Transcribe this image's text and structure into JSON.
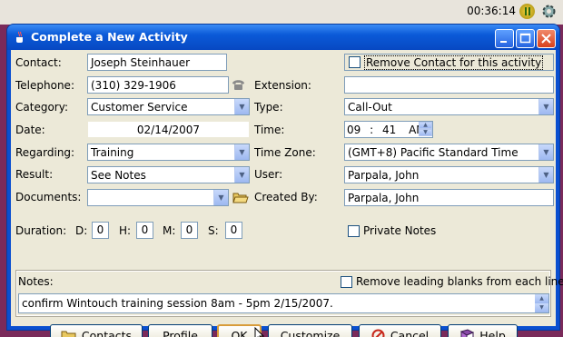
{
  "taskbar": {
    "clock": "00:36:14"
  },
  "window": {
    "title": "Complete a New Activity"
  },
  "form": {
    "contact_label": "Contact:",
    "contact_value": "Joseph Steinhauer",
    "remove_contact_label": "Remove Contact for this activity",
    "telephone_label": "Telephone:",
    "telephone_value": "(310) 329-1906",
    "extension_label": "Extension:",
    "extension_value": "",
    "category_label": "Category:",
    "category_value": "Customer Service",
    "type_label": "Type:",
    "type_value": "Call-Out",
    "date_label": "Date:",
    "date_value": "02/14/2007",
    "time_label": "Time:",
    "time_hour": "09",
    "time_sep": ":",
    "time_min": "41",
    "time_ampm": "AM",
    "regarding_label": "Regarding:",
    "regarding_value": "Training",
    "timezone_label": "Time Zone:",
    "timezone_value": "(GMT+8) Pacific Standard Time",
    "result_label": "Result:",
    "result_value": "See Notes",
    "user_label": "User:",
    "user_value": "Parpala, John",
    "documents_label": "Documents:",
    "documents_value": "",
    "created_by_label": "Created By:",
    "created_by_value": "Parpala, John",
    "duration_label": "Duration:",
    "d_label": "D:",
    "d_value": "0",
    "h_label": "H:",
    "h_value": "0",
    "m_label": "M:",
    "m_value": "0",
    "s_label": "S:",
    "s_value": "0",
    "private_notes_label": "Private Notes",
    "notes_label": "Notes:",
    "remove_blanks_label": "Remove leading blanks from each line",
    "notes_value": "confirm Wintouch training session 8am - 5pm 2/15/2007."
  },
  "buttons": {
    "contacts": "Contacts",
    "profile": "Profile",
    "ok": "OK",
    "customize": "Customize",
    "cancel": "Cancel",
    "help": "Help"
  },
  "colors": {
    "title_bar": "#0b5ad8",
    "dialog_bg": "#ece9d8",
    "desktop": "#7a2a5a"
  }
}
